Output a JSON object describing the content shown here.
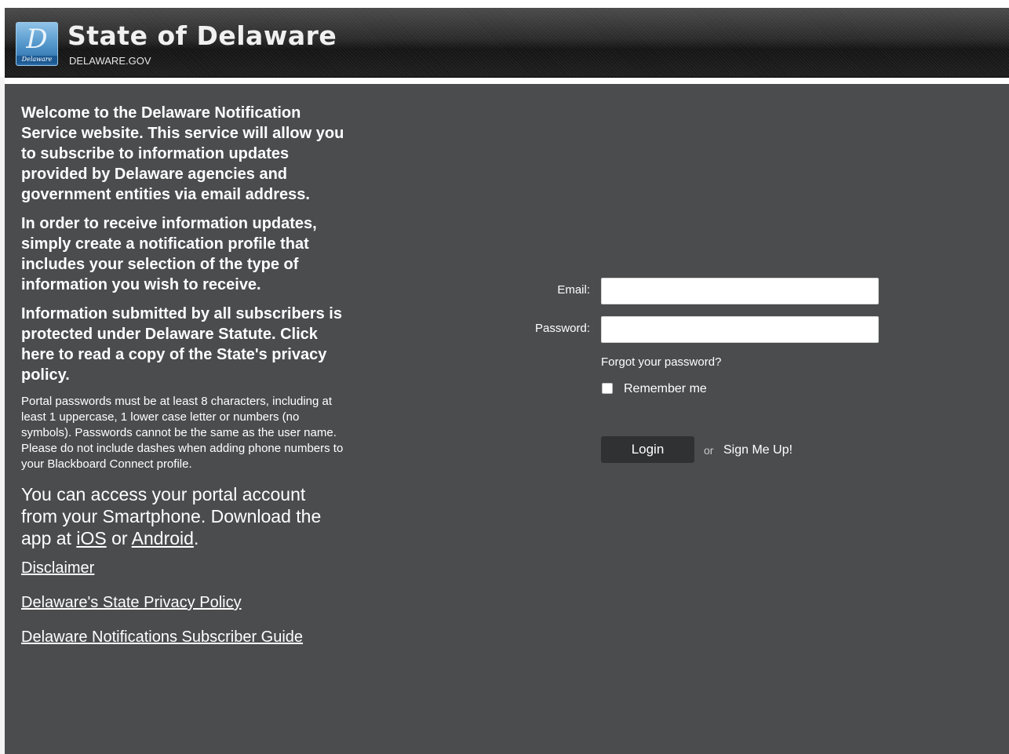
{
  "header": {
    "title": "State of Delaware",
    "subtitle": "DELAWARE.GOV",
    "logo_text": "Delaware",
    "logo_glyph": "D"
  },
  "info": {
    "para1": "Welcome to the Delaware Notification Service website. This service will allow you to subscribe to information updates provided by Delaware agencies and government entities via email address.",
    "para2": "In order to receive information updates, simply create a notification profile that includes your selection of the type of information you wish to receive.",
    "para3": "Information submitted by all subscribers is protected under Delaware Statute. Click here to read a copy of the State's privacy policy.",
    "para4": "Portal passwords must be at least 8 characters, including at least 1 uppercase, 1 lower case letter or numbers (no symbols). Passwords cannot be the same as the user name. Please do not include dashes when adding phone numbers to your Blackboard Connect profile.",
    "app_prefix": "You can access your portal account from your Smartphone. Download the app at ",
    "ios_link": "iOS",
    "app_or": " or ",
    "android_link": "Android",
    "app_suffix": ".",
    "links": {
      "disclaimer": "Disclaimer",
      "privacy_policy": "Delaware's State Privacy Policy",
      "subscriber_guide": "Delaware Notifications Subscriber Guide"
    }
  },
  "login": {
    "email_label": "Email:",
    "email_value": "",
    "password_label": "Password:",
    "password_value": "",
    "forgot_password": "Forgot your password?",
    "remember_me": "Remember me",
    "login_button": "Login",
    "or_text": "or",
    "signup_link": "Sign Me Up!"
  },
  "colors": {
    "panel_bg": "#4a4c4e",
    "button_bg": "#2f3133",
    "text": "#ffffff"
  }
}
